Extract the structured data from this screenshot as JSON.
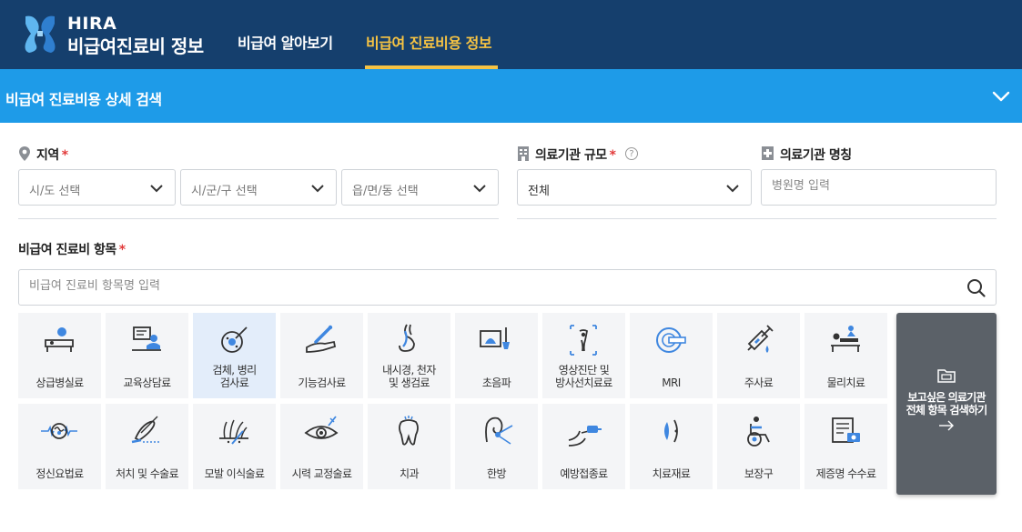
{
  "header": {
    "brand_top": "HIRA",
    "brand_bottom": "비급여진료비 정보",
    "nav": [
      {
        "label": "비급여 알아보기",
        "active": false
      },
      {
        "label": "비급여 진료비용 정보",
        "active": true
      }
    ]
  },
  "search_panel": {
    "title": "비급여 진료비용 상세 검색",
    "toggle_icon": "chevron-down-icon"
  },
  "region": {
    "label": "지역",
    "required_mark": "*",
    "icon": "map-pin-icon",
    "selects": [
      {
        "placeholder": "시/도 선택"
      },
      {
        "placeholder": "시/군/구 선택"
      },
      {
        "placeholder": "읍/면/동 선택"
      }
    ]
  },
  "institution_scale": {
    "label": "의료기관 규모",
    "required_mark": "*",
    "icon": "building-icon",
    "help_icon": "help-circle-icon",
    "selected": "전체"
  },
  "institution_name": {
    "label": "의료기관 명칭",
    "icon": "hospital-icon",
    "placeholder": "병원명 입력"
  },
  "item": {
    "label": "비급여 진료비 항목",
    "required_mark": "*",
    "placeholder": "비급여 진료비 항목명 입력",
    "search_icon": "search-icon"
  },
  "categories": [
    {
      "lines": [
        "상급병실료"
      ],
      "icon": "hospital-bed-icon",
      "selected": false
    },
    {
      "lines": [
        "교육상담료"
      ],
      "icon": "counseling-icon",
      "selected": false
    },
    {
      "lines": [
        "검체, 병리",
        "검사료"
      ],
      "icon": "pathology-icon",
      "selected": true
    },
    {
      "lines": [
        "기능검사료"
      ],
      "icon": "function-test-icon",
      "selected": false
    },
    {
      "lines": [
        "내시경, 천자",
        "및 생검료"
      ],
      "icon": "endoscope-icon",
      "selected": false
    },
    {
      "lines": [
        "초음파"
      ],
      "icon": "ultrasound-icon",
      "selected": false
    },
    {
      "lines": [
        "영상진단 및",
        "방사선치료료"
      ],
      "icon": "radiology-icon",
      "selected": false
    },
    {
      "lines": [
        "MRI"
      ],
      "icon": "mri-icon",
      "selected": false
    },
    {
      "lines": [
        "주사료"
      ],
      "icon": "syringe-icon",
      "selected": false
    },
    {
      "lines": [
        "물리치료"
      ],
      "icon": "physical-therapy-icon",
      "selected": false
    },
    {
      "lines": [
        "정신요법료"
      ],
      "icon": "brain-icon",
      "selected": false
    },
    {
      "lines": [
        "처치 및 수술료"
      ],
      "icon": "surgery-icon",
      "selected": false
    },
    {
      "lines": [
        "모발 이식술료"
      ],
      "icon": "hair-transplant-icon",
      "selected": false
    },
    {
      "lines": [
        "시력 교정술료"
      ],
      "icon": "eye-icon",
      "selected": false
    },
    {
      "lines": [
        "치과"
      ],
      "icon": "tooth-icon",
      "selected": false
    },
    {
      "lines": [
        "한방"
      ],
      "icon": "acupuncture-icon",
      "selected": false
    },
    {
      "lines": [
        "예방접종료"
      ],
      "icon": "vaccine-icon",
      "selected": false
    },
    {
      "lines": [
        "치료재료"
      ],
      "icon": "treatment-material-icon",
      "selected": false
    },
    {
      "lines": [
        "보장구"
      ],
      "icon": "wheelchair-icon",
      "selected": false
    },
    {
      "lines": [
        "제증명 수수료"
      ],
      "icon": "certificate-icon",
      "selected": false
    }
  ],
  "all_items_button": {
    "lines": [
      "보고싶은 의료기관",
      "전체 항목 검색하기"
    ],
    "icon": "folder-icon",
    "arrow_icon": "arrow-right-icon"
  },
  "colors": {
    "header_bg": "#153f6d",
    "panel_bg": "#1e9be8",
    "nav_active": "#f6c343",
    "required": "#e23b3b",
    "tile_bg": "#f4f5f7",
    "tile_selected_bg": "#e3edfa",
    "accent_icon": "#3f87e0"
  }
}
